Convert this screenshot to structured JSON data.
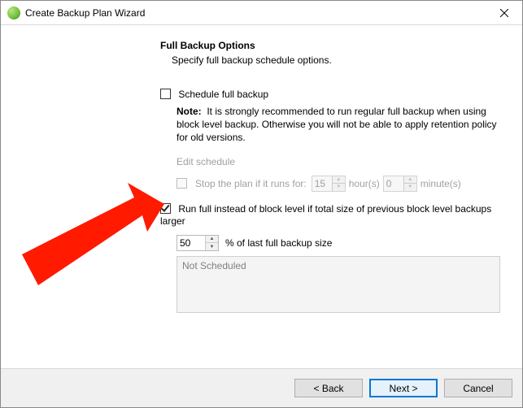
{
  "window": {
    "title": "Create Backup Plan Wizard"
  },
  "header": {
    "title": "Full Backup Options",
    "subtitle": "Specify full backup schedule options."
  },
  "options": {
    "schedule_full_label": "Schedule full backup",
    "schedule_full_checked": false,
    "note_prefix": "Note:",
    "note_text": "It is strongly recommended to run regular full backup when using block level backup. Otherwise you will not be able to apply retention policy for old versions.",
    "edit_schedule": "Edit schedule",
    "stop_label": "Stop the plan if it runs for:",
    "stop_hours": "15",
    "stop_hours_unit": "hour(s)",
    "stop_minutes": "0",
    "stop_minutes_unit": "minute(s)",
    "run_full_label": "Run full instead of block level if total size of previous block level backups larger",
    "run_full_checked": true,
    "pct_value": "50",
    "pct_suffix": "% of last full backup size",
    "status": "Not Scheduled"
  },
  "buttons": {
    "back": "< Back",
    "next": "Next >",
    "cancel": "Cancel"
  }
}
